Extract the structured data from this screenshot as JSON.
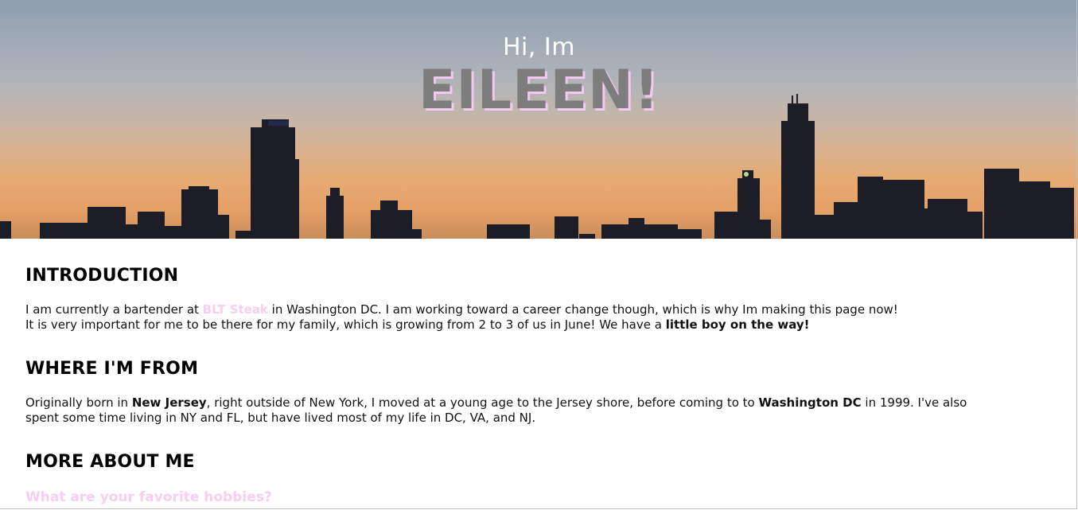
{
  "hero": {
    "greeting": "Hi, Im",
    "name": "EILEEN!"
  },
  "introduction": {
    "heading": "INTRODUCTION",
    "line1_before": "I am currently a bartender at ",
    "line1_link": "BLT Steak",
    "line1_after": " in Washington DC. I am working toward a career change though, which is why Im making this page now!",
    "line2_before": "It is very important for me to be there for my family, which is growing from 2 to 3 of us in June! We have a ",
    "line2_bold": "little boy on the way!"
  },
  "where_from": {
    "heading": "WHERE I'M FROM",
    "text_1": "Originally born in ",
    "bold_1": "New Jersey",
    "text_2": ", right outside of New York, I moved at a young age to the Jersey shore, before coming to to ",
    "bold_2": "Washington DC",
    "text_3": " in 1999. I've also spent some time living in NY and FL, but have lived most of my life in DC, VA, and NJ."
  },
  "more_about": {
    "heading": "MORE ABOUT ME",
    "question": "What are your favorite hobbies?"
  },
  "colors": {
    "accent_pink": "#f7cdf1",
    "name_gray": "#7d7d7d"
  }
}
